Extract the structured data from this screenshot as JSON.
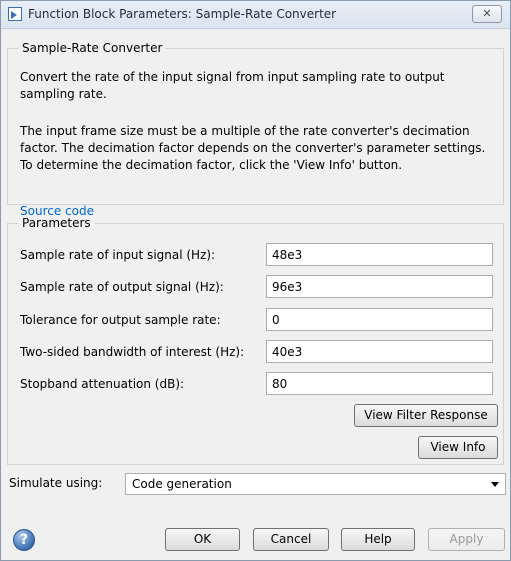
{
  "window": {
    "title": "Function Block Parameters: Sample-Rate Converter",
    "close_label": "✕"
  },
  "description": {
    "group_label": "Sample-Rate Converter",
    "paragraph1": "Convert the rate of the input signal from input sampling rate to output sampling rate.",
    "paragraph2": "The input frame size must be a multiple of the rate converter's decimation factor. The decimation factor depends on the converter's parameter settings. To determine the decimation factor, click the 'View Info' button.",
    "link": "Source code"
  },
  "parameters": {
    "group_label": "Parameters",
    "fields": [
      {
        "label": "Sample rate of input signal (Hz):",
        "value": "48e3"
      },
      {
        "label": "Sample rate of output signal (Hz):",
        "value": "96e3"
      },
      {
        "label": "Tolerance for output sample rate:",
        "value": "0"
      },
      {
        "label": "Two-sided bandwidth of interest (Hz):",
        "value": "40e3"
      },
      {
        "label": "Stopband attenuation (dB):",
        "value": "80"
      }
    ],
    "view_filter_response": "View Filter Response",
    "view_info": "View Info"
  },
  "simulate": {
    "label": "Simulate using:",
    "selected": "Code generation"
  },
  "footer": {
    "help_icon_glyph": "?",
    "ok": "OK",
    "cancel": "Cancel",
    "help": "Help",
    "apply": "Apply"
  }
}
